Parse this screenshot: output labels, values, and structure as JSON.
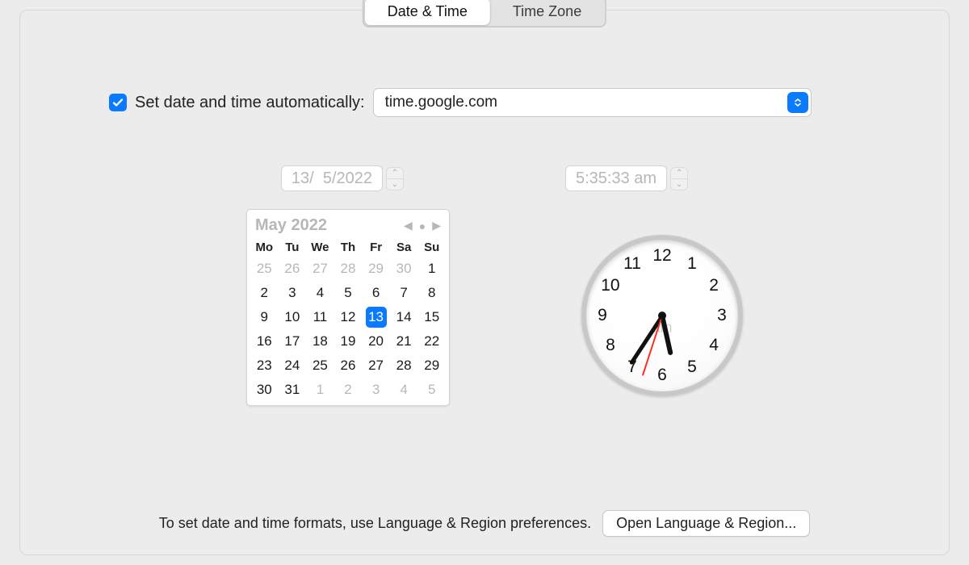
{
  "tabs": {
    "date_time": "Date & Time",
    "time_zone": "Time Zone",
    "active": "date_time"
  },
  "auto": {
    "label": "Set date and time automatically:",
    "checked": true,
    "server": "time.google.com"
  },
  "date_field": "13/  5/2022",
  "time_field": "5:35:33 am",
  "calendar": {
    "title": "May 2022",
    "weekdays": [
      "Mo",
      "Tu",
      "We",
      "Th",
      "Fr",
      "Sa",
      "Su"
    ],
    "cells": [
      {
        "n": "25",
        "other": true
      },
      {
        "n": "26",
        "other": true
      },
      {
        "n": "27",
        "other": true
      },
      {
        "n": "28",
        "other": true
      },
      {
        "n": "29",
        "other": true
      },
      {
        "n": "30",
        "other": true
      },
      {
        "n": "1"
      },
      {
        "n": "2"
      },
      {
        "n": "3"
      },
      {
        "n": "4"
      },
      {
        "n": "5"
      },
      {
        "n": "6"
      },
      {
        "n": "7"
      },
      {
        "n": "8"
      },
      {
        "n": "9"
      },
      {
        "n": "10"
      },
      {
        "n": "11"
      },
      {
        "n": "12"
      },
      {
        "n": "13",
        "selected": true
      },
      {
        "n": "14"
      },
      {
        "n": "15"
      },
      {
        "n": "16"
      },
      {
        "n": "17"
      },
      {
        "n": "18"
      },
      {
        "n": "19"
      },
      {
        "n": "20"
      },
      {
        "n": "21"
      },
      {
        "n": "22"
      },
      {
        "n": "23"
      },
      {
        "n": "24"
      },
      {
        "n": "25"
      },
      {
        "n": "26"
      },
      {
        "n": "27"
      },
      {
        "n": "28"
      },
      {
        "n": "29"
      },
      {
        "n": "30"
      },
      {
        "n": "31"
      },
      {
        "n": "1",
        "other": true
      },
      {
        "n": "2",
        "other": true
      },
      {
        "n": "3",
        "other": true
      },
      {
        "n": "4",
        "other": true
      },
      {
        "n": "5",
        "other": true
      }
    ]
  },
  "clock": {
    "numbers": [
      "12",
      "1",
      "2",
      "3",
      "4",
      "5",
      "6",
      "7",
      "8",
      "9",
      "10",
      "11"
    ],
    "ampm": "am",
    "hour": 5,
    "minute": 35,
    "second": 33
  },
  "footer": {
    "hint": "To set date and time formats, use Language & Region preferences.",
    "button": "Open Language & Region..."
  }
}
